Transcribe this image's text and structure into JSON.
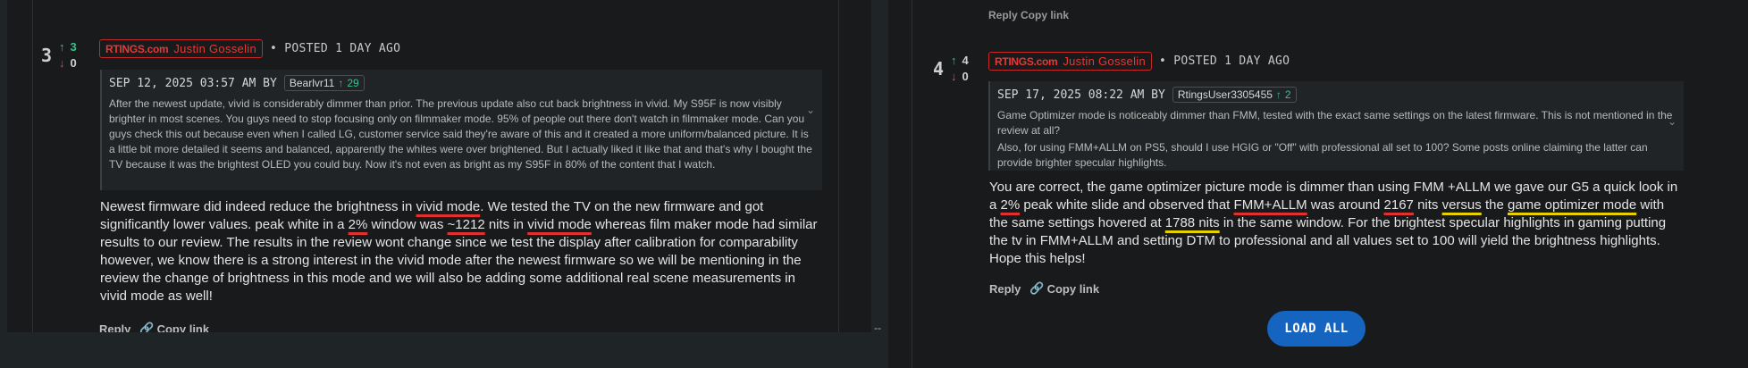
{
  "left": {
    "rank": "3",
    "upvotes": "3",
    "downvotes": "0",
    "logo": "RTINGS.com",
    "author": "Justin Gosselin",
    "posted": "• POSTED 1 DAY AGO",
    "quote": {
      "date": "SEP 12, 2025 03:57 AM BY",
      "user": "Bearlvr11",
      "user_votes": "29",
      "text": "After the newest update, vivid is considerably dimmer than prior. The previous update also cut back brightness in vivid. My S95F is now visibly brighter in most scenes. You guys need to stop focusing only on filmmaker mode. 95% of people out there don't watch in filmmaker mode. Can you guys check this out because even when I called LG, customer service said they're aware of this and it created a more uniform/balanced picture. It is a little bit more detailed it seems and balanced, apparently the whites were over brightened. But I actually liked it like that and that's why I bought the TV because it was the brightest OLED you could buy. Now it's not even as bright as my S95F in 80% of the content that I watch."
    },
    "reply": {
      "p1": "Newest firmware did indeed reduce the brightness in ",
      "h1": "vivid mode",
      "p2": ". We tested the TV on the new firmware and got significantly lower values. peak white in a ",
      "h2": "2%",
      "p3": " window was ",
      "h3": "~1212",
      "p4": " nits in ",
      "h4": "vivid mode",
      "p5": " whereas film maker mode had similar results to our review. The results in the review wont change since we test the display after calibration for comparability however, we know there is a strong interest in the vivid mode after the newest firmware so we will be mentioning in the review the change of brightness in this mode and we will also be adding some additional real scene measurements in vivid mode as well!"
    },
    "reply_label": "Reply",
    "copy_link_label": "Copy link"
  },
  "right": {
    "top_actions": "Reply   Copy link",
    "rank": "4",
    "upvotes": "4",
    "downvotes": "0",
    "logo": "RTINGS.com",
    "author": "Justin Gosselin",
    "posted": "• POSTED 1 DAY AGO",
    "quote": {
      "date": "SEP 17, 2025 08:22 AM BY",
      "user": "RtingsUser3305455",
      "user_votes": "2",
      "text1": "Game Optimizer mode is noticeably dimmer than FMM, tested with the exact same settings on the latest firmware. This is not mentioned in the review at all?",
      "text2": "Also, for using FMM+ALLM on PS5, should I use HGIG or \"Off\" with professional all set to 100? Some posts online claiming the latter can provide brighter specular highlights."
    },
    "reply": {
      "p1": "You are correct, the game optimizer picture mode is dimmer than using FMM +ALLM we gave our G5 a quick look in a ",
      "h1": "2%",
      "p2": " peak white slide and observed that ",
      "h2": "FMM+ALLM",
      "p3": " was around ",
      "h3": "2167",
      "p4": " nits ",
      "h4": "versus",
      "p5": " the ",
      "h5": "game optimizer mode",
      "p6": " with the same settings hovered at ",
      "h6": "1788 nits",
      "p7": " in the same window. For the brightest specular highlights in gaming putting the tv in FMM+ALLM and setting DTM to professional and all values set to 100 will yield the brightness highlights. Hope this helps!"
    },
    "reply_label": "Reply",
    "copy_link_label": "Copy link",
    "load_all_label": "LOAD ALL"
  },
  "separator": "--",
  "colors": {
    "accent": "#e53935",
    "upvote": "#35c28a",
    "downvote": "#e5484d",
    "button": "#1565c0",
    "underline_red": "#e03030",
    "underline_yellow": "#e6d000"
  }
}
